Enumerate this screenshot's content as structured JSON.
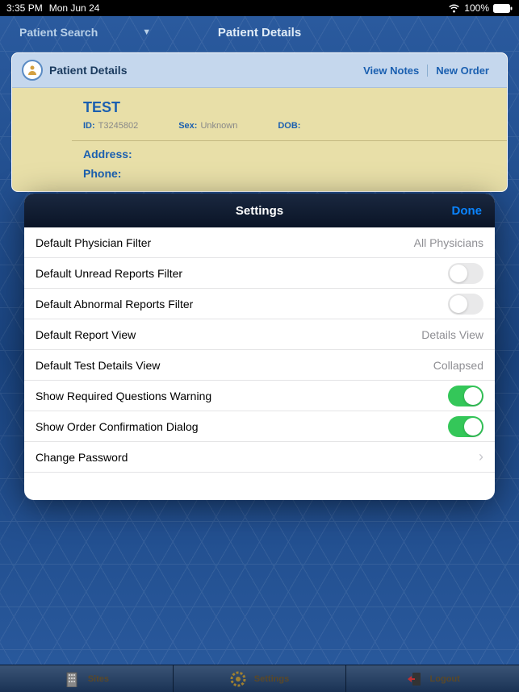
{
  "status": {
    "time": "3:35 PM",
    "date": "Mon Jun 24",
    "battery": "100%"
  },
  "nav": {
    "dropdown_label": "Patient Search",
    "title": "Patient Details"
  },
  "patient_card": {
    "title": "Patient Details",
    "view_notes": "View Notes",
    "new_order": "New Order",
    "name": "TEST",
    "id_label": "ID:",
    "id_value": "T3245802",
    "sex_label": "Sex:",
    "sex_value": "Unknown",
    "dob_label": "DOB:",
    "dob_value": "",
    "address_label": "Address:",
    "phone_label": "Phone:"
  },
  "modal": {
    "title": "Settings",
    "done": "Done",
    "items": [
      {
        "label": "Default Physician Filter",
        "type": "value",
        "value": "All Physicians"
      },
      {
        "label": "Default Unread Reports Filter",
        "type": "toggle",
        "on": false
      },
      {
        "label": "Default Abnormal Reports Filter",
        "type": "toggle",
        "on": false
      },
      {
        "label": "Default Report View",
        "type": "value",
        "value": "Details View"
      },
      {
        "label": "Default Test Details View",
        "type": "value",
        "value": "Collapsed"
      },
      {
        "label": "Show Required Questions Warning",
        "type": "toggle",
        "on": true
      },
      {
        "label": "Show Order Confirmation Dialog",
        "type": "toggle",
        "on": true
      },
      {
        "label": "Change Password",
        "type": "nav"
      }
    ]
  },
  "tabs": {
    "sites": "Sites",
    "settings": "Settings",
    "logout": "Logout"
  }
}
